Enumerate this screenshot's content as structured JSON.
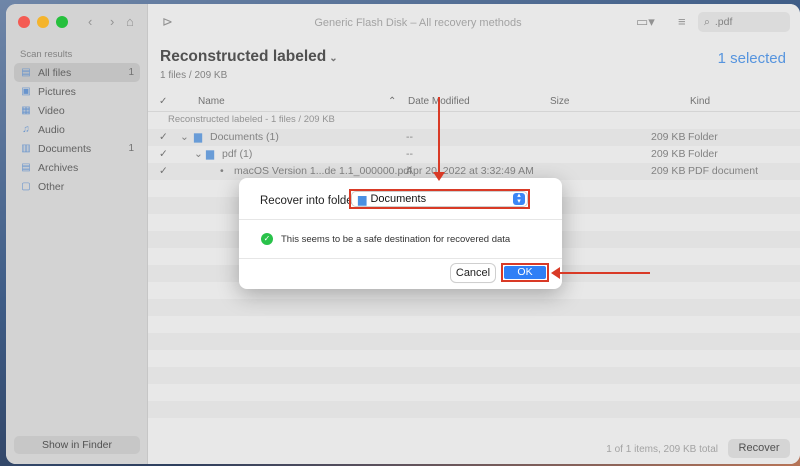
{
  "window": {
    "title": "Generic Flash Disk – All recovery methods"
  },
  "sidebar": {
    "section_title": "Scan results",
    "items": [
      {
        "label": "All files",
        "count": "1",
        "icon": "files-icon",
        "active": true
      },
      {
        "label": "Pictures",
        "count": "",
        "icon": "picture-icon"
      },
      {
        "label": "Video",
        "count": "",
        "icon": "video-icon"
      },
      {
        "label": "Audio",
        "count": "",
        "icon": "music-icon"
      },
      {
        "label": "Documents",
        "count": "1",
        "icon": "document-icon"
      },
      {
        "label": "Archives",
        "count": "",
        "icon": "archive-icon"
      },
      {
        "label": "Other",
        "count": "",
        "icon": "other-icon"
      }
    ],
    "show_in_finder": "Show in Finder"
  },
  "toolbar": {
    "search_value": ".pdf"
  },
  "main": {
    "heading": "Reconstructed labeled",
    "subheading": "1 files / 209 KB",
    "selected_count": "1 selected",
    "columns": {
      "name": "Name",
      "date": "Date Modified",
      "size": "Size",
      "kind": "Kind"
    },
    "group_row": "Reconstructed labeled - 1 files / 209 KB",
    "rows": [
      {
        "name": "Documents (1)",
        "date": "--",
        "size": "209 KB",
        "kind": "Folder"
      },
      {
        "name": "pdf (1)",
        "date": "--",
        "size": "209 KB",
        "kind": "Folder"
      },
      {
        "name": "macOS Version 1...de 1.1_000000.pdf",
        "date": "Apr 20, 2022 at 3:32:49 AM",
        "size": "209 KB",
        "kind": "PDF document"
      }
    ],
    "footer_count": "1 of 1 items, 209 KB total",
    "recover_label": "Recover"
  },
  "dialog": {
    "label": "Recover into folder",
    "folder_value": "Documents",
    "message": "This seems to be a safe destination for recovered data",
    "cancel_label": "Cancel",
    "ok_label": "OK"
  },
  "colors": {
    "accent": "#2f7ff6",
    "annotation": "#d93a26",
    "success": "#29c24a"
  }
}
